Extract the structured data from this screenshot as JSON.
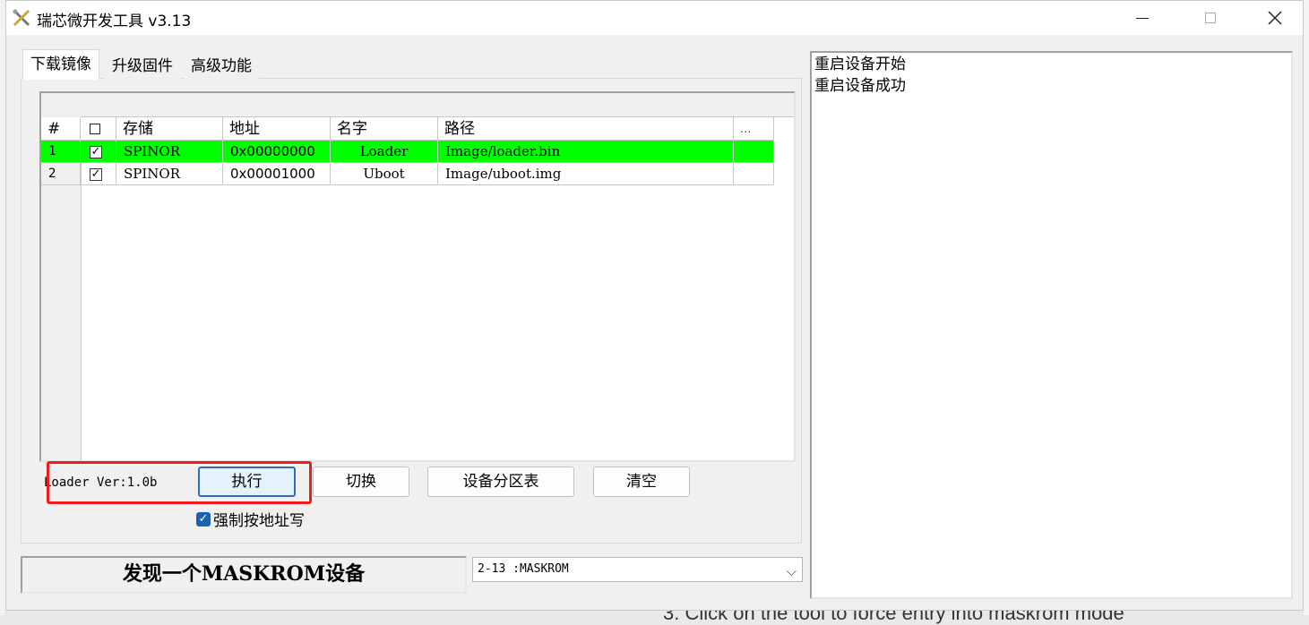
{
  "window": {
    "title": "瑞芯微开发工具 v3.13"
  },
  "tabs": [
    {
      "label": "下载镜像",
      "active": true
    },
    {
      "label": "升级固件",
      "active": false
    },
    {
      "label": "高级功能",
      "active": false
    }
  ],
  "table": {
    "headers": {
      "num": "#",
      "check": "",
      "storage": "存储",
      "address": "地址",
      "name": "名字",
      "path": "路径",
      "more": "..."
    },
    "rows": [
      {
        "num": "1",
        "checked": true,
        "storage": "SPINOR",
        "address": "0x00000000",
        "name": "Loader",
        "path": "Image/loader.bin",
        "selected": true
      },
      {
        "num": "2",
        "checked": true,
        "storage": "SPINOR",
        "address": "0x00001000",
        "name": "Uboot",
        "path": "Image/uboot.img",
        "selected": false
      }
    ]
  },
  "loader_version": "Loader Ver:1.0b",
  "buttons": {
    "run": "执行",
    "switch": "切换",
    "partition_table": "设备分区表",
    "clear": "清空"
  },
  "force_address_write": {
    "label": "强制按地址写",
    "checked": true
  },
  "status": "发现一个MASKROM设备",
  "device_select": {
    "value": "2-13 :MASKROM"
  },
  "log": [
    "重启设备开始",
    "重启设备成功"
  ],
  "background_page": {
    "text": "3. Click on the tool to force entry into maskrom mode"
  },
  "colors": {
    "selected_row": "#00ff00",
    "highlight_box": "#ee1c1c",
    "checkbox_blue": "#1a62b0"
  }
}
